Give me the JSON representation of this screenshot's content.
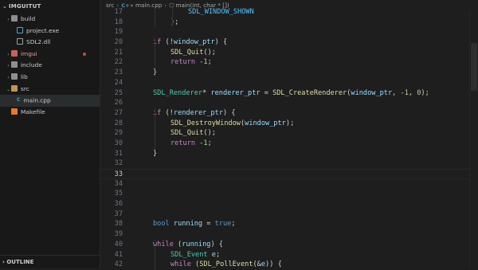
{
  "explorer": {
    "project": "IMGUITUT",
    "items": [
      {
        "label": "build",
        "kind": "folder-gray",
        "indent": 1,
        "twist": "›"
      },
      {
        "label": "project.exe",
        "kind": "exe",
        "indent": 2,
        "twist": ""
      },
      {
        "label": "SDL2.dll",
        "kind": "dll",
        "indent": 2,
        "twist": ""
      },
      {
        "label": "imgui",
        "kind": "folder-red",
        "indent": 1,
        "twist": "›",
        "modified": true
      },
      {
        "label": "include",
        "kind": "folder-gray",
        "indent": 1,
        "twist": "›"
      },
      {
        "label": "lib",
        "kind": "folder-gray",
        "indent": 1,
        "twist": "›"
      },
      {
        "label": "src",
        "kind": "folder",
        "indent": 1,
        "twist": "⌄"
      },
      {
        "label": "main.cpp",
        "kind": "cpp",
        "indent": 2,
        "twist": "",
        "active": true
      },
      {
        "label": "Makefile",
        "kind": "make",
        "indent": 1,
        "twist": ""
      }
    ],
    "outline": "OUTLINE"
  },
  "breadcrumb": {
    "folder": "src",
    "file": "main.cpp",
    "file_tag": "C++",
    "symbol": "main(int, char * [])"
  },
  "code": {
    "current_line": 33,
    "lines": [
      {
        "n": 17,
        "indent": 2,
        "tokens": [
          [
            "SDL_WINDOW_SHOWN",
            "mac"
          ]
        ]
      },
      {
        "n": 18,
        "indent": 1,
        "tokens": [
          [
            ");",
            "p"
          ]
        ]
      },
      {
        "n": 19,
        "indent": 0,
        "tokens": []
      },
      {
        "n": 20,
        "indent": 0,
        "tokens": [
          [
            "if",
            "kw"
          ],
          [
            " (",
            "p"
          ],
          [
            "!",
            "p"
          ],
          [
            "window_ptr",
            "var"
          ],
          [
            ") {",
            "p"
          ]
        ]
      },
      {
        "n": 21,
        "indent": 1,
        "tokens": [
          [
            "SDL_Quit",
            "fn"
          ],
          [
            "();",
            "p"
          ]
        ]
      },
      {
        "n": 22,
        "indent": 1,
        "tokens": [
          [
            "return",
            "kw"
          ],
          [
            " -",
            "p"
          ],
          [
            "1",
            "num"
          ],
          [
            ";",
            "p"
          ]
        ]
      },
      {
        "n": 23,
        "indent": 0,
        "tokens": [
          [
            "}",
            "p"
          ]
        ]
      },
      {
        "n": 24,
        "indent": 0,
        "tokens": []
      },
      {
        "n": 25,
        "indent": 0,
        "tokens": [
          [
            "SDL_Renderer",
            "ty"
          ],
          [
            "* ",
            "p"
          ],
          [
            "renderer_ptr",
            "var"
          ],
          [
            " = ",
            "p"
          ],
          [
            "SDL_CreateRenderer",
            "fn"
          ],
          [
            "(",
            "p"
          ],
          [
            "window_ptr",
            "var"
          ],
          [
            ", -",
            "p"
          ],
          [
            "1",
            "num"
          ],
          [
            ", ",
            "p"
          ],
          [
            "0",
            "num"
          ],
          [
            ");",
            "p"
          ]
        ]
      },
      {
        "n": 26,
        "indent": 0,
        "tokens": []
      },
      {
        "n": 27,
        "indent": 0,
        "tokens": [
          [
            "if",
            "kw"
          ],
          [
            " (",
            "p"
          ],
          [
            "!",
            "p"
          ],
          [
            "renderer_ptr",
            "var"
          ],
          [
            ") {",
            "p"
          ]
        ]
      },
      {
        "n": 28,
        "indent": 1,
        "tokens": [
          [
            "SDL_DestroyWindow",
            "fn"
          ],
          [
            "(",
            "p"
          ],
          [
            "window_ptr",
            "var"
          ],
          [
            ");",
            "p"
          ]
        ]
      },
      {
        "n": 29,
        "indent": 1,
        "tokens": [
          [
            "SDL_Quit",
            "fn"
          ],
          [
            "();",
            "p"
          ]
        ]
      },
      {
        "n": 30,
        "indent": 1,
        "tokens": [
          [
            "return",
            "kw"
          ],
          [
            " -",
            "p"
          ],
          [
            "1",
            "num"
          ],
          [
            ";",
            "p"
          ]
        ]
      },
      {
        "n": 31,
        "indent": 0,
        "tokens": [
          [
            "}",
            "p"
          ]
        ]
      },
      {
        "n": 32,
        "indent": 0,
        "tokens": []
      },
      {
        "n": 33,
        "indent": 0,
        "tokens": []
      },
      {
        "n": 34,
        "indent": 0,
        "tokens": []
      },
      {
        "n": 35,
        "indent": 0,
        "tokens": []
      },
      {
        "n": 36,
        "indent": 0,
        "tokens": []
      },
      {
        "n": 37,
        "indent": 0,
        "tokens": []
      },
      {
        "n": 38,
        "indent": 0,
        "tokens": [
          [
            "bool",
            "ok"
          ],
          [
            " ",
            "p"
          ],
          [
            "running",
            "var"
          ],
          [
            " = ",
            "p"
          ],
          [
            "true",
            "ok"
          ],
          [
            ";",
            "p"
          ]
        ]
      },
      {
        "n": 39,
        "indent": 0,
        "tokens": []
      },
      {
        "n": 40,
        "indent": 0,
        "tokens": [
          [
            "while",
            "kw"
          ],
          [
            " (",
            "p"
          ],
          [
            "running",
            "var"
          ],
          [
            ") {",
            "p"
          ]
        ]
      },
      {
        "n": 41,
        "indent": 1,
        "tokens": [
          [
            "SDL_Event",
            "ty"
          ],
          [
            " ",
            "p"
          ],
          [
            "e",
            "var"
          ],
          [
            ";",
            "p"
          ]
        ]
      },
      {
        "n": 42,
        "indent": 1,
        "tokens": [
          [
            "while",
            "kw"
          ],
          [
            " (",
            "p"
          ],
          [
            "SDL_PollEvent",
            "fn"
          ],
          [
            "(&",
            "p"
          ],
          [
            "e",
            "var"
          ],
          [
            ")) {",
            "p"
          ]
        ]
      }
    ]
  },
  "colors": {
    "background": "#1e1e1e",
    "sidebar": "#181818",
    "keyword": "#c586c0",
    "type": "#4ec9b0",
    "function": "#dcdcaa",
    "variable": "#9cdcfe",
    "number": "#b5cea8"
  }
}
